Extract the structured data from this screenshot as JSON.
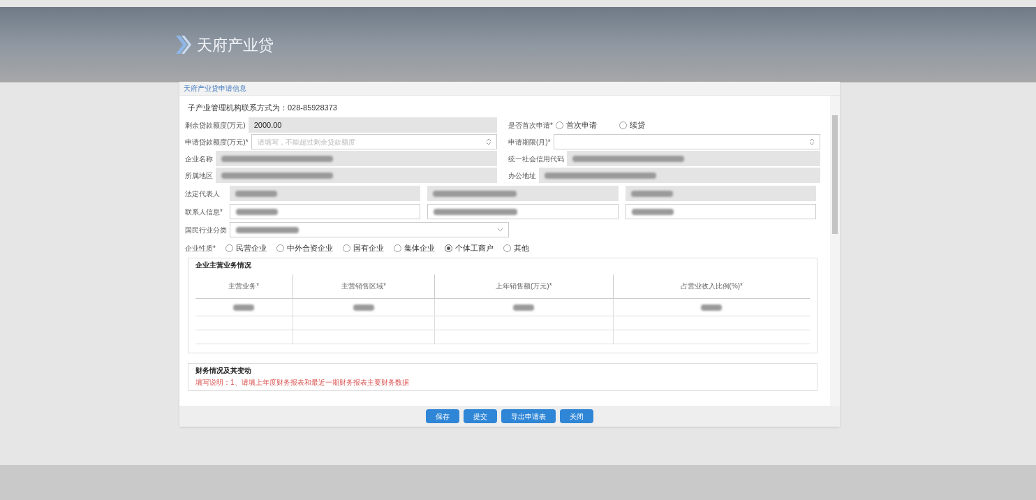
{
  "header": {
    "logo_text": "天府产业贷"
  },
  "dialog": {
    "title": "天府产业贷申请信息",
    "contact_note": "子产业管理机构联系方式为：028-85928373",
    "fields_top": [
      {
        "label": "剩余贷款额度(万元)",
        "value": "2000.00",
        "kind": "readonly"
      },
      {
        "label": "是否首次申请*",
        "kind": "radio",
        "options": [
          {
            "label": "首次申请",
            "selected": false
          },
          {
            "label": "续贷",
            "selected": false
          }
        ]
      },
      {
        "label": "申请贷款额度(万元)*",
        "placeholder": "请填写，不能超过剩余贷款额度",
        "kind": "spinner"
      },
      {
        "label": "申请期限(月)*",
        "kind": "spinner"
      },
      {
        "label": "企业名称",
        "kind": "redacted"
      },
      {
        "label": "统一社会信用代码",
        "kind": "redacted"
      },
      {
        "label": "所属地区",
        "kind": "redacted"
      },
      {
        "label": "办公地址",
        "kind": "redacted"
      }
    ],
    "triple_rows": [
      {
        "label": "法定代表人",
        "readonly": true
      },
      {
        "label": "联系人信息*",
        "readonly": false
      }
    ],
    "industry": {
      "label": "国民行业分类"
    },
    "nature": {
      "label": "企业性质*",
      "options": [
        {
          "label": "民营企业",
          "selected": false
        },
        {
          "label": "中外合资企业",
          "selected": false
        },
        {
          "label": "国有企业",
          "selected": false
        },
        {
          "label": "集体企业",
          "selected": false
        },
        {
          "label": "个体工商户",
          "selected": true
        },
        {
          "label": "其他",
          "selected": false
        }
      ]
    },
    "business": {
      "title": "企业主营业务情况",
      "columns": [
        "主营业务*",
        "主营销售区域*",
        "上年销售额(万元)*",
        "占营业收入比例(%)*"
      ]
    },
    "finance": {
      "title": "财务情况及其变动",
      "note": "填写说明：1、请填上年度财务报表和最近一期财务报表主要财务数据"
    },
    "buttons": [
      "保存",
      "提交",
      "导出申请表",
      "关闭"
    ]
  }
}
